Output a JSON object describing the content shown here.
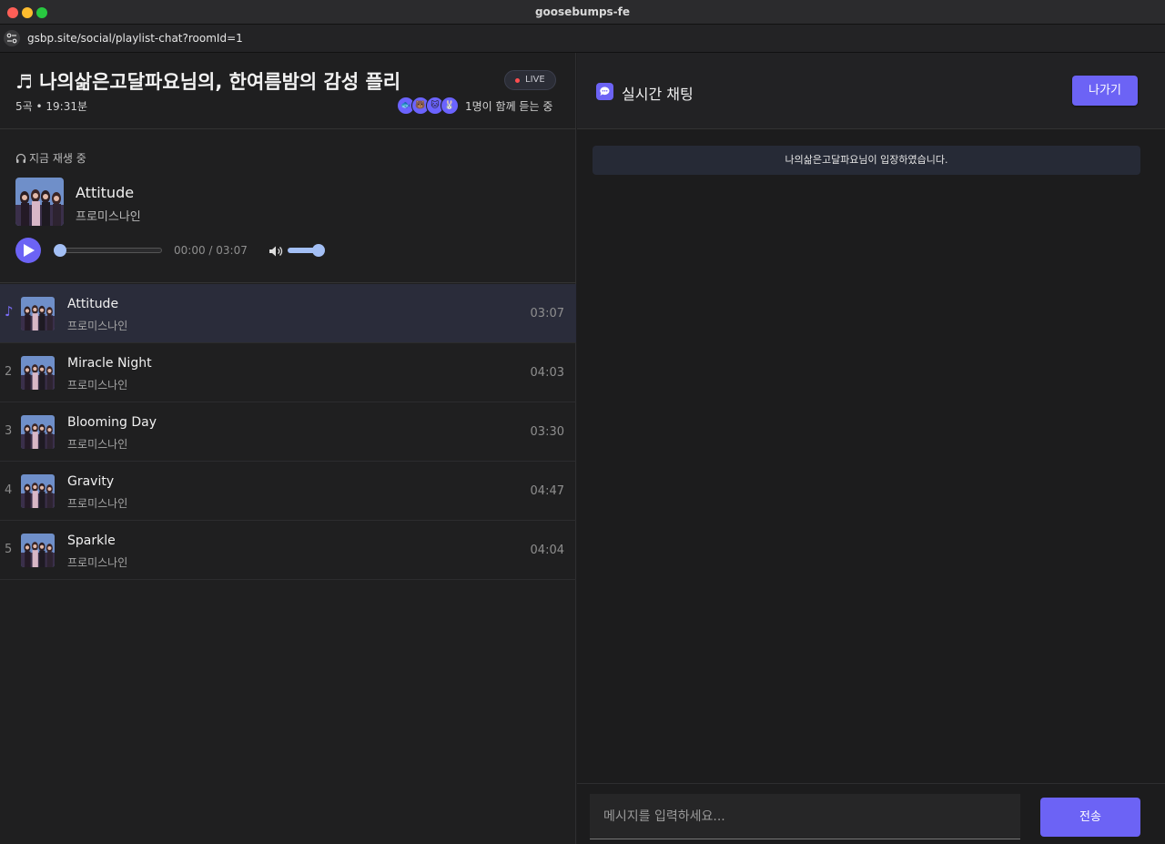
{
  "window": {
    "title": "goosebumps-fe"
  },
  "address": {
    "url": "gsbp.site/social/playlist-chat?roomId=1"
  },
  "playlist": {
    "title_icon": "♬",
    "title": "나의삶은고달파요님의, 한여름밤의 감성 플리",
    "meta": "5곡 • 19:31분",
    "live": "LIVE",
    "listeners": "1명이 함께 듣는 중",
    "avatars": [
      "🐟",
      "🐻",
      "🐱",
      "🐰"
    ]
  },
  "now_playing": {
    "label": "지금 재생 중",
    "title": "Attitude",
    "artist": "프로미스나인",
    "time": "00:00 / 03:07",
    "progress": 0,
    "volume": 0.8
  },
  "tracks": [
    {
      "num": "♪",
      "title": "Attitude",
      "artist": "프로미스나인",
      "duration": "03:07",
      "active": true
    },
    {
      "num": "2",
      "title": "Miracle Night",
      "artist": "프로미스나인",
      "duration": "04:03"
    },
    {
      "num": "3",
      "title": "Blooming Day",
      "artist": "프로미스나인",
      "duration": "03:30"
    },
    {
      "num": "4",
      "title": "Gravity",
      "artist": "프로미스나인",
      "duration": "04:47"
    },
    {
      "num": "5",
      "title": "Sparkle",
      "artist": "프로미스나인",
      "duration": "04:04"
    }
  ],
  "chat": {
    "title": "실시간 채팅",
    "leave": "나가기",
    "system_message": "나의삶은고달파요님이 입장하였습니다.",
    "input_placeholder": "메시지를 입력하세요...",
    "send": "전송"
  },
  "colors": {
    "accent": "#6c63f5",
    "live_dot": "#ff4d4f",
    "active_row": "#2a2c3a"
  }
}
